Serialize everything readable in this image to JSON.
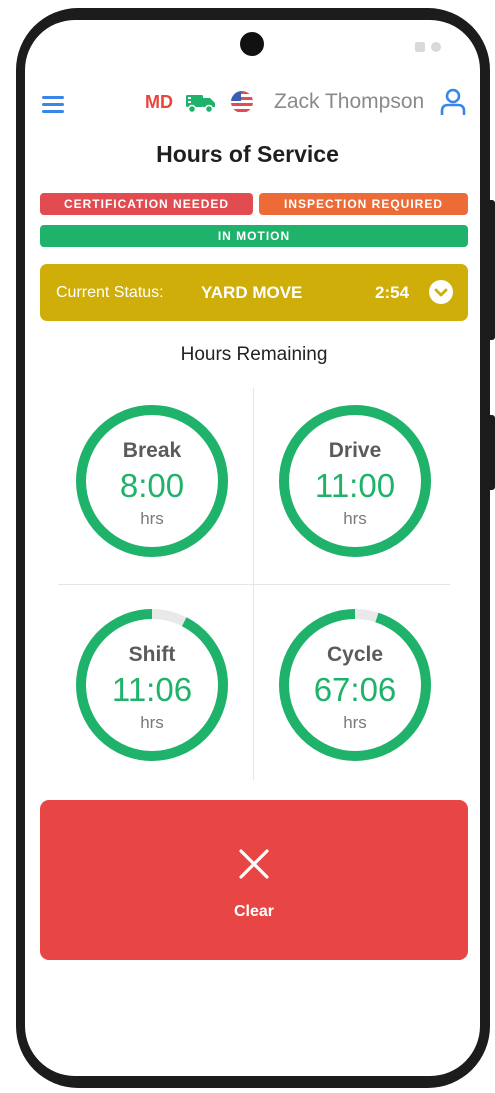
{
  "header": {
    "state": "MD",
    "user_name": "Zack Thompson"
  },
  "page_title": "Hours of Service",
  "badges": {
    "certification": "CERTIFICATION NEEDED",
    "inspection": "INSPECTION REQUIRED",
    "motion": "IN MOTION"
  },
  "current_status": {
    "label": "Current Status:",
    "value": "YARD MOVE",
    "time": "2:54"
  },
  "hours_remaining_label": "Hours Remaining",
  "gauges": [
    {
      "name": "Break",
      "value": "8:00",
      "unit": "hrs",
      "fraction": 1.0
    },
    {
      "name": "Drive",
      "value": "11:00",
      "unit": "hrs",
      "fraction": 1.0
    },
    {
      "name": "Shift",
      "value": "11:06",
      "unit": "hrs",
      "fraction": 0.925
    },
    {
      "name": "Cycle",
      "value": "67:06",
      "unit": "hrs",
      "fraction": 0.95
    }
  ],
  "clear_button": {
    "label": "Clear"
  },
  "colors": {
    "accent_blue": "#3a86e8",
    "gauge_green": "#1fb26a",
    "status_yellow": "#cfae0a",
    "alert_red": "#e84545",
    "warning_orange": "#ec6b36"
  }
}
